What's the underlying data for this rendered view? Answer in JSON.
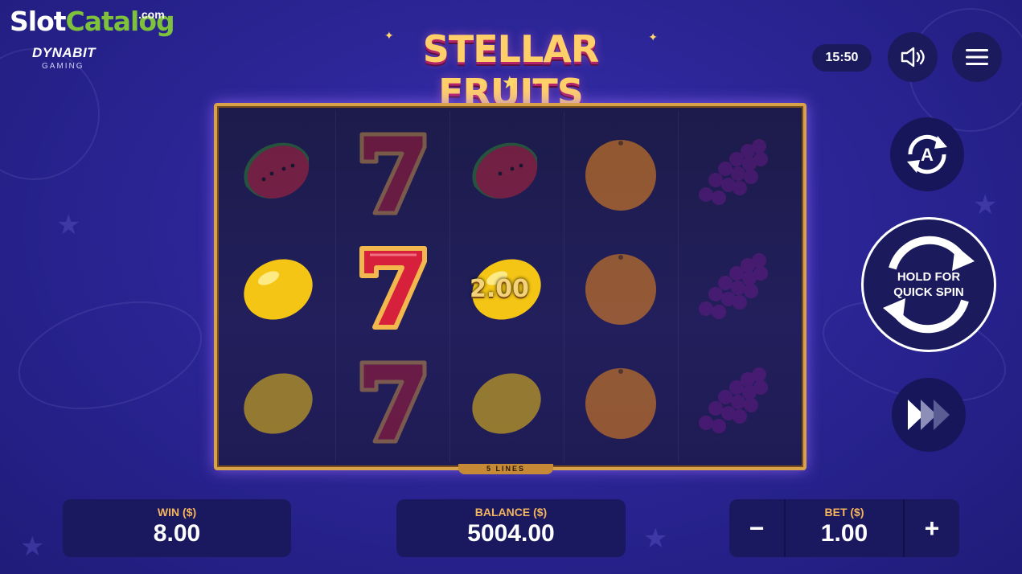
{
  "brand": {
    "logo_part1": "Slot",
    "logo_part2": "Catalog",
    "domain": ".com",
    "provider": "DYNABIT",
    "provider_sub": "GAMING"
  },
  "game": {
    "title": "STELLAR FRUITS"
  },
  "header": {
    "clock": "15:50",
    "sound_icon": "speaker-icon",
    "menu_icon": "hamburger-menu-icon"
  },
  "reels": {
    "columns": [
      [
        "watermelon",
        "lemon",
        "lemon"
      ],
      [
        "seven",
        "seven",
        "seven"
      ],
      [
        "watermelon",
        "lemon",
        "lemon"
      ],
      [
        "orange",
        "orange",
        "orange"
      ],
      [
        "grapes",
        "grapes",
        "grapes"
      ]
    ],
    "highlighted": [
      [
        1,
        1
      ],
      [
        2,
        1
      ]
    ],
    "win_amount_label": "2.00",
    "lines_label": "5 LINES"
  },
  "controls": {
    "autoplay_icon": "autoplay-icon",
    "spin_label": "HOLD FOR QUICK SPIN",
    "turbo_icon": "fast-forward-icon"
  },
  "footer": {
    "win_label": "WIN ($)",
    "win_value": "8.00",
    "balance_label": "BALANCE ($)",
    "balance_value": "5004.00",
    "bet_label": "BET ($)",
    "bet_value": "1.00",
    "minus": "−",
    "plus": "+"
  },
  "colors": {
    "accent": "#f3b45c",
    "frame": "#d7a24a",
    "panel": "#1a1960",
    "brand_green": "#7ec23c"
  }
}
